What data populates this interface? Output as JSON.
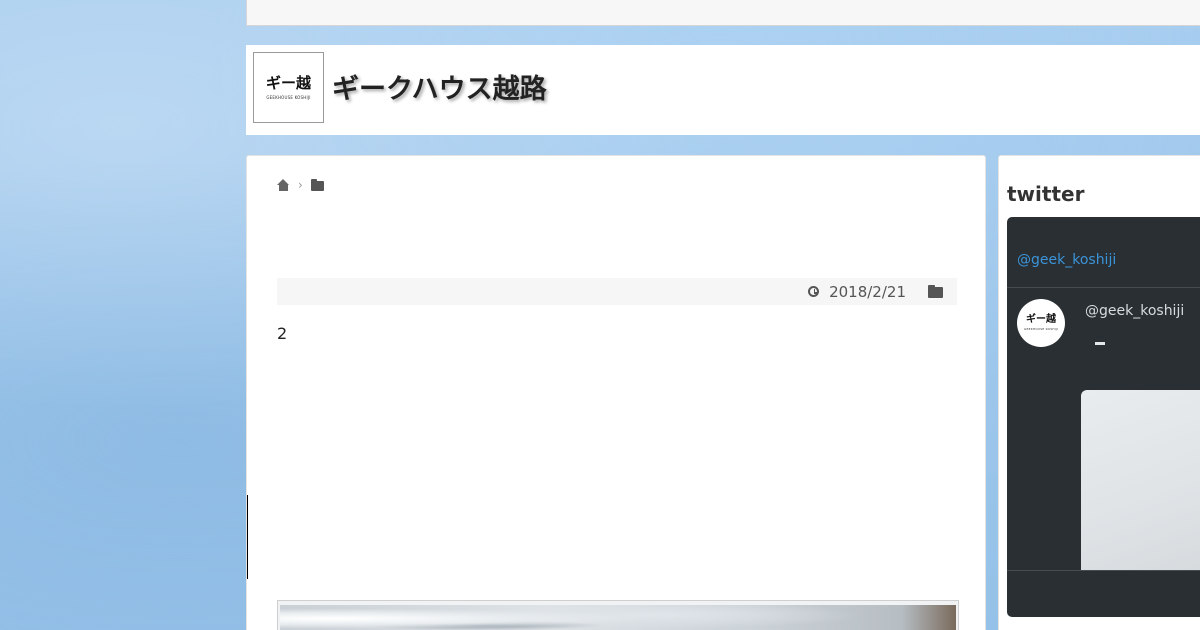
{
  "header": {
    "logo_text": "ギー越",
    "logo_subtext": "GEEKHOUSE KOSHIJI",
    "site_title": "ギークハウス越路"
  },
  "breadcrumb": {
    "items": [
      {
        "icon": "home-icon"
      },
      {
        "icon": "folder-icon"
      }
    ],
    "separator": "›"
  },
  "post": {
    "date": "2018/2/21",
    "body_text": "2"
  },
  "sidebar": {
    "widget_title": "twitter",
    "timeline": {
      "handle_link": "@geek_koshiji",
      "tweet_user": "@geek_koshiji",
      "avatar_text": "ギー越",
      "avatar_subtext": "GEEKHOUSE KOSHIJI"
    }
  },
  "colors": {
    "background": "#9cc6ea",
    "twitter_panel": "#292f33",
    "link_blue": "#3b94d9"
  }
}
